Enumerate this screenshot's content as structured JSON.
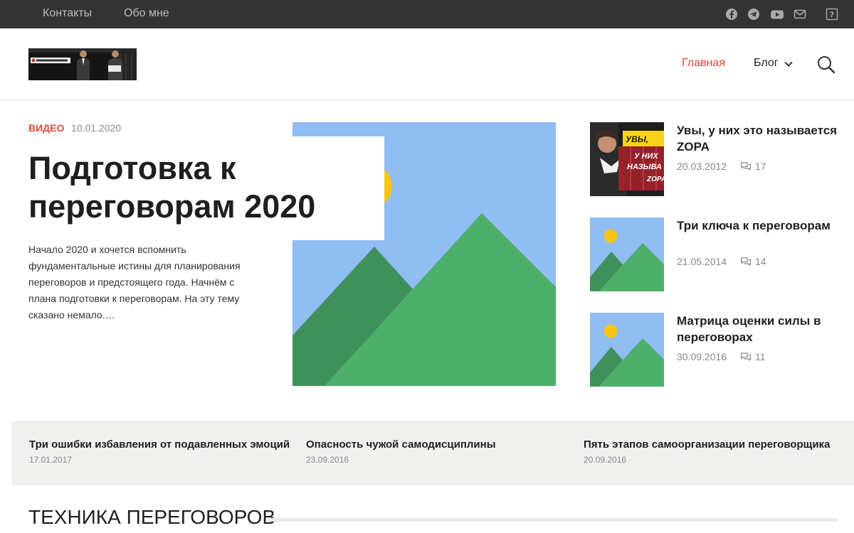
{
  "topbar": {
    "links": [
      "Контакты",
      "Обо мне"
    ],
    "social_icons": [
      "facebook-icon",
      "telegram-icon",
      "youtube-icon",
      "mail-icon",
      "help-icon"
    ]
  },
  "header": {
    "nav": {
      "home": "Главная",
      "blog": "Блог"
    }
  },
  "hero": {
    "category": "Видео",
    "date": "10.01.2020",
    "title": "Подготовка к переговорам 2020",
    "excerpt": "Начало 2020 и хочется вспомнить фундаментальные истины для планирования переговоров и предстоящего года. Начнём с плана подготовки к переговорам. На эту тему сказано немало.…"
  },
  "side_posts": [
    {
      "title": "Увы, у них это называется ZOPA",
      "date": "20.03.2012",
      "comments": "17",
      "thumb_text": [
        "УВЫ,",
        "У НИХ",
        "НАЗЫВА",
        "ZOPA"
      ]
    },
    {
      "title": "Три ключа к переговорам",
      "date": "21.05.2014",
      "comments": "14"
    },
    {
      "title": "Матрица оценки силы в переговорах",
      "date": "30.09.2016",
      "comments": "11"
    }
  ],
  "strip": [
    {
      "title": "Три ошибки избавления от подавленных эмоций",
      "date": "17.01.2017"
    },
    {
      "title": "Опасность чужой самодисциплины",
      "date": "23.09.2016"
    },
    {
      "title": "Пять этапов самоорганизации переговорщика",
      "date": "20.09.2016"
    }
  ],
  "section": {
    "title": "Техника переговоров"
  },
  "colors": {
    "accent": "#e2473d",
    "topbar": "#333333",
    "sky": "#90bdf2",
    "hill_dark": "#3f915c",
    "hill_light": "#4caf6a",
    "sun": "#f8c515"
  }
}
